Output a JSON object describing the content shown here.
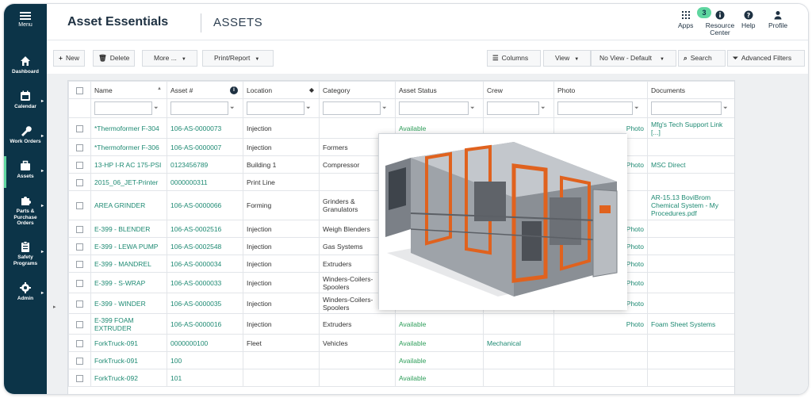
{
  "sidebar": {
    "menu_label": "Menu",
    "items": [
      {
        "label": "Dashboard",
        "icon": "home-icon"
      },
      {
        "label": "Calendar",
        "icon": "calendar-icon"
      },
      {
        "label": "Work Orders",
        "icon": "wrench-icon"
      },
      {
        "label": "Assets",
        "icon": "briefcase-icon"
      },
      {
        "label": "Parts & Purchase Orders",
        "icon": "puzzle-icon"
      },
      {
        "label": "Safety Programs",
        "icon": "clipboard-icon"
      },
      {
        "label": "Admin",
        "icon": "gear-icon"
      }
    ]
  },
  "header": {
    "brand": "Asset Essentials",
    "section": "ASSETS",
    "apps_label": "Apps",
    "resource_label": "Resource Center",
    "resource_badge": "3",
    "help_label": "Help",
    "profile_label": "Profile"
  },
  "toolbar": {
    "new": "New",
    "delete": "Delete",
    "more": "More ...",
    "print": "Print/Report",
    "columns": "Columns",
    "view": "View",
    "no_view": "No View - Default",
    "search": "Search",
    "advanced": "Advanced Filters"
  },
  "table": {
    "columns": [
      "Name",
      "Asset #",
      "Location",
      "Category",
      "Asset Status",
      "Crew",
      "Photo",
      "Documents"
    ],
    "rows": [
      {
        "name": "*Thermoformer F-304",
        "asset": "106-AS-0000073",
        "location": "Injection",
        "category": "",
        "status": "Available",
        "crew": "",
        "photo": "Photo",
        "docs": "Mfg's Tech Support Link  [...]"
      },
      {
        "name": "*Thermoformer F-306",
        "asset": "106-AS-0000007",
        "location": "Injection",
        "category": "Formers",
        "status": "",
        "crew": "",
        "photo": "",
        "docs": ""
      },
      {
        "name": "13-HP I-R AC 175-PSI",
        "asset": "0123456789",
        "location": "Building 1",
        "category": "Compressor",
        "status": "",
        "crew": "",
        "photo": "Photo",
        "docs": "MSC Direct"
      },
      {
        "name": "2015_06_JET-Printer",
        "asset": "0000000311",
        "location": "Print Line",
        "category": "",
        "status": "",
        "crew": "",
        "photo": "",
        "docs": ""
      },
      {
        "name": "AREA GRINDER",
        "asset": "106-AS-0000066",
        "location": "Forming",
        "category": "Grinders & Granulators",
        "status": "",
        "crew": "",
        "photo": "",
        "docs": "AR-15.13 BoviBrom Chemical System - My Procedures.pdf"
      },
      {
        "name": "E-399 - BLENDER",
        "asset": "106-AS-0002516",
        "location": "Injection",
        "category": "Weigh Blenders",
        "status": "",
        "crew": "",
        "photo": "Photo",
        "docs": ""
      },
      {
        "name": "E-399 - LEWA PUMP",
        "asset": "106-AS-0002548",
        "location": "Injection",
        "category": "Gas Systems",
        "status": "",
        "crew": "",
        "photo": "Photo",
        "docs": ""
      },
      {
        "name": "E-399 - MANDREL",
        "asset": "106-AS-0000034",
        "location": "Injection",
        "category": "Extruders",
        "status": "",
        "crew": "",
        "photo": "Photo",
        "docs": ""
      },
      {
        "name": "E-399 - S-WRAP",
        "asset": "106-AS-0000033",
        "location": "Injection",
        "category": "Winders-Coilers-Spoolers",
        "status": "",
        "crew": "",
        "photo": "Photo",
        "docs": ""
      },
      {
        "name": "E-399 - WINDER",
        "asset": "106-AS-0000035",
        "location": "Injection",
        "category": "Winders-Coilers-Spoolers",
        "status": "",
        "crew": "",
        "photo": "Photo",
        "docs": ""
      },
      {
        "name": "E-399 FOAM EXTRUDER",
        "asset": "106-AS-0000016",
        "location": "Injection",
        "category": "Extruders",
        "status": "Available",
        "crew": "",
        "photo": "Photo",
        "docs": "Foam Sheet Systems"
      },
      {
        "name": "ForkTruck-091",
        "asset": "0000000100",
        "location": "Fleet",
        "category": "Vehicles",
        "status": "Available",
        "crew": "Mechanical",
        "photo": "",
        "docs": ""
      },
      {
        "name": "ForkTruck-091",
        "asset": "100",
        "location": "",
        "category": "",
        "status": "Available",
        "crew": "",
        "photo": "",
        "docs": ""
      },
      {
        "name": "ForkTruck-092",
        "asset": "101",
        "location": "",
        "category": "",
        "status": "Available",
        "crew": "",
        "photo": "",
        "docs": ""
      }
    ]
  },
  "colors": {
    "sidebar": "#0c3448",
    "accent": "#5fd6a0",
    "link": "#1e8a73",
    "status_available": "#2e9e5a"
  }
}
